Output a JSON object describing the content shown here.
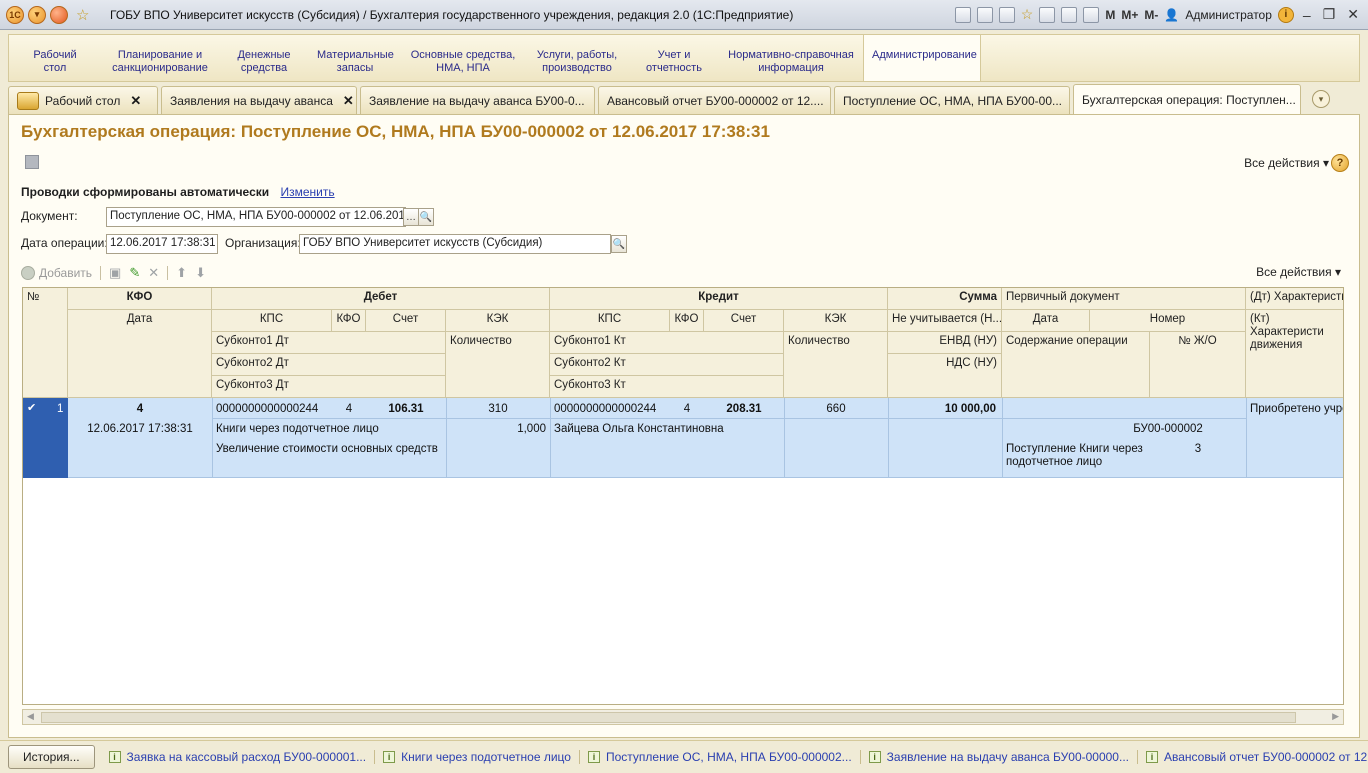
{
  "window": {
    "title": "ГОБУ ВПО Университет искусств (Субсидия) / Бухгалтерия государственного учреждения, редакция 2.0  (1С:Предприятие)",
    "m_buttons": [
      "M",
      "M+",
      "M-"
    ],
    "user": "Администратор"
  },
  "sections": [
    {
      "label": "Рабочий\nстол"
    },
    {
      "label": "Планирование и\nсанкционирование"
    },
    {
      "label": "Денежные\nсредства"
    },
    {
      "label": "Материальные\nзапасы"
    },
    {
      "label": "Основные средства,\nНМА, НПА"
    },
    {
      "label": "Услуги, работы,\nпроизводство"
    },
    {
      "label": "Учет и\nотчетность"
    },
    {
      "label": "Нормативно-справочная\nинформация"
    },
    {
      "label": "Администрирование"
    }
  ],
  "tabs": [
    {
      "label": "Рабочий стол"
    },
    {
      "label": "Заявления на выдачу аванса"
    },
    {
      "label": "Заявление на выдачу аванса БУ00-0..."
    },
    {
      "label": "Авансовый отчет БУ00-000002 от 12...."
    },
    {
      "label": "Поступление ОС, НМА, НПА БУ00-00..."
    },
    {
      "label": "Бухгалтерская операция: Поступлен..."
    }
  ],
  "form": {
    "title": "Бухгалтерская операция: Поступление ОС, НМА, НПА БУ00-000002 от 12.06.2017 17:38:31",
    "all_actions": "Все действия",
    "auto_text": "Проводки сформированы автоматически",
    "change_link": "Изменить",
    "document_label": "Документ:",
    "document_value": "Поступление ОС, НМА, НПА БУ00-000002 от 12.06.2017 1",
    "date_label": "Дата операции:",
    "date_value": "12.06.2017 17:38:31",
    "org_label": "Организация:",
    "org_value": "ГОБУ ВПО Университет искусств (Субсидия)",
    "add_label": "Добавить",
    "all_actions_table": "Все действия"
  },
  "table": {
    "headers": {
      "num": "№",
      "kfo": "КФО",
      "debit": "Дебет",
      "credit": "Кредит",
      "sum": "Сумма",
      "primary_doc": "Первичный документ",
      "dt_char": "(Дт) Характеристи",
      "date": "Дата",
      "kps_dt": "КПС",
      "kfo_dt": "КФО",
      "acc_dt": "Счет",
      "kek_dt": "КЭК",
      "kps_kt": "КПС",
      "kfo_kt": "КФО",
      "acc_kt": "Счет",
      "kek_kt": "КЭК",
      "not_counted": "Не учитывается (Н...",
      "pd_date": "Дата",
      "pd_number": "Номер",
      "kt_char": "(Кт) Характеристи",
      "kt_char2": "движения",
      "sub1_dt": "Субконто1 Дт",
      "qty_dt": "Количество",
      "sub1_kt": "Субконто1 Кт",
      "qty_kt": "Количество",
      "envd": "ЕНВД (НУ)",
      "content": "Содержание операции",
      "journal": "№ Ж/О",
      "sub2_dt": "Субконто2 Дт",
      "sub2_kt": "Субконто2 Кт",
      "vat": "НДС (НУ)",
      "sub3_dt": "Субконто3 Дт",
      "sub3_kt": "Субконто3 Кт"
    },
    "row": {
      "num": "1",
      "kfo": "4",
      "date": "12.06.2017 17:38:31",
      "kps_dt": "0000000000000244",
      "kfo_dt": "4",
      "acc_dt": "106.31",
      "kek_dt": "310",
      "sub1_dt": "Книги через подотчетное лицо",
      "qty_dt": "1,000",
      "sub2_dt": "Увеличение стоимости основных средств",
      "kps_kt": "0000000000000244",
      "kfo_kt": "4",
      "acc_kt": "208.31",
      "kek_kt": "660",
      "sub1_kt": "Зайцева Ольга Константиновна",
      "sum": "10 000,00",
      "pd_number": "БУ00-000002",
      "content": "Поступление Книги через подотчетное лицо",
      "journal": "3",
      "dt_char": "Приобретено учре:"
    }
  },
  "history": {
    "button": "История...",
    "items": [
      "Заявка на кассовый расход БУ00-000001...",
      "Книги через подотчетное лицо",
      "Поступление ОС, НМА, НПА БУ00-000002...",
      "Заявление на выдачу аванса БУ00-00000...",
      "Авансовый отчет БУ00-000002 от 12.06.2..."
    ]
  },
  "colors": {
    "title_accent": "#b07a1e",
    "selection": "#cfe3f8",
    "link": "#2a3fb0"
  }
}
